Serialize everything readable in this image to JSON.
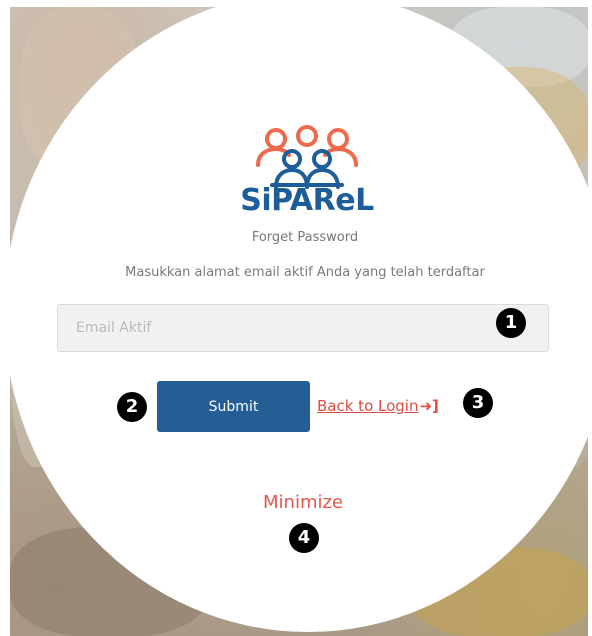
{
  "brand": {
    "name": "SiPAReL",
    "colors": {
      "primary": "#1d5d99",
      "accent": "#ee6a4c"
    }
  },
  "form": {
    "subtitle": "Forget Password",
    "instruction": "Masukkan alamat email aktif Anda yang telah terdaftar",
    "email_placeholder": "Email Aktif",
    "email_value": "",
    "submit_label": "Submit",
    "back_label": "Back to Login",
    "back_icon": "sign-in-icon"
  },
  "footer": {
    "minimize_label": "Minimize"
  },
  "callouts": [
    "1",
    "2",
    "3",
    "4"
  ]
}
